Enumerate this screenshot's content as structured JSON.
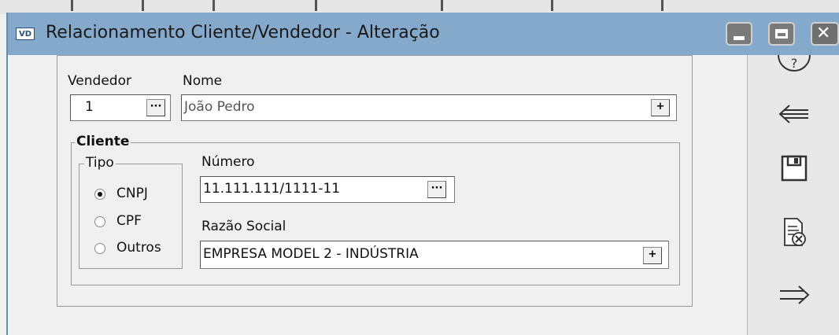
{
  "window": {
    "title": "Relacionamento Cliente/Vendedor - Alteração",
    "icon_text": "VD",
    "buttons": [
      "minimize-icon",
      "maximize-icon",
      "close-icon"
    ]
  },
  "form": {
    "vendedor_label": "Vendedor",
    "vendedor_value": "1",
    "nome_label": "Nome",
    "nome_value": "João Pedro",
    "cliente_group": "Cliente",
    "tipo_group": "Tipo",
    "tipo_options": [
      "CNPJ",
      "CPF",
      "Outros"
    ],
    "tipo_selected": "CNPJ",
    "numero_label": "Número",
    "numero_value": "11.111.111/1111-11",
    "razao_label": "Razão Social",
    "razao_value": "EMPRESA MODEL 2 - INDÚSTRIA",
    "browse_glyph": "···",
    "add_glyph": "+"
  },
  "sidebar": {
    "icons": [
      "help-icon",
      "back-arrow-icon",
      "save-icon",
      "cancel-document-icon",
      "forward-arrow-icon"
    ]
  }
}
